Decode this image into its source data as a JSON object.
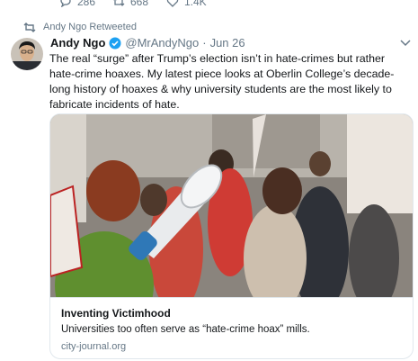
{
  "actions": {
    "reply_count": "286",
    "retweet_count": "668",
    "like_count": "1.4K"
  },
  "retweet_notice": "Andy Ngo Retweeted",
  "tweet": {
    "author_name": "Andy Ngo",
    "author_handle": "@MrAndyNgo",
    "separator": "·",
    "date": "Jun 26",
    "text": "The real “surge” after Trump’s election isn’t in hate-crimes but rather hate-crime hoaxes. My latest piece looks at Oberlin College’s decade-long history of hoaxes & why university students are the most likely to fabricate incidents of hate."
  },
  "card": {
    "title": "Inventing Victimhood",
    "description": "Universities too often serve as “hate-crime hoax” mills.",
    "domain": "city-journal.org"
  },
  "colors": {
    "accent": "#1da1f2",
    "secondary_text": "#657786",
    "border": "#e1e8ed"
  },
  "icons": [
    "reply-icon",
    "retweet-icon",
    "like-icon",
    "verified-badge-icon",
    "chevron-down-icon"
  ]
}
